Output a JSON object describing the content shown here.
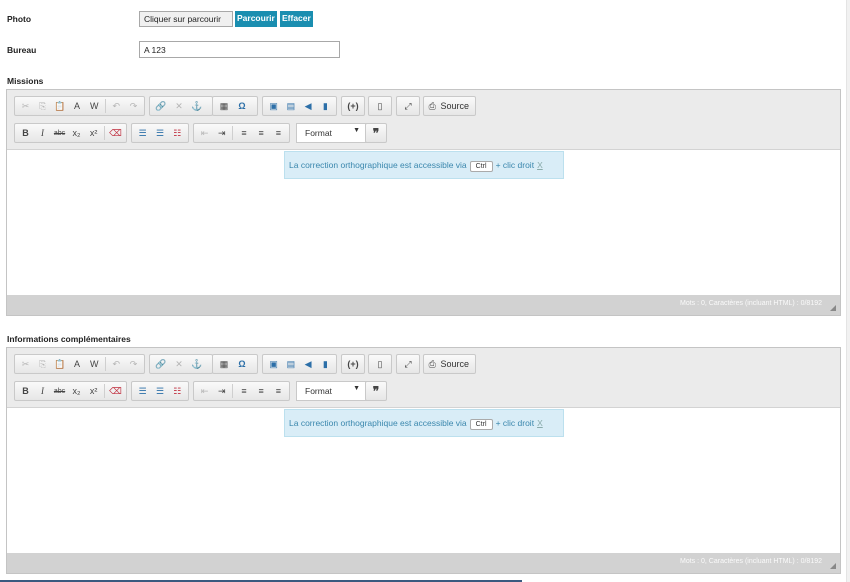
{
  "photo": {
    "label": "Photo",
    "file_button": "Cliquer sur parcourir",
    "browse": "Parcourir",
    "clear": "Effacer"
  },
  "bureau": {
    "label": "Bureau",
    "value": "A 123"
  },
  "editor_common": {
    "source": "Source",
    "format": "Format",
    "spell_pre": "La correction orthographique est accessible via",
    "spell_key": "Ctrl",
    "spell_post": "+ clic droit",
    "spell_close": "X",
    "word_count": "Mots : 0, Caractères (incluant HTML) : 0/8192"
  },
  "missions": {
    "label": "Missions"
  },
  "infos": {
    "label": "Informations complémentaires"
  },
  "colors": {
    "accent": "#1a8eb0",
    "notice_bg": "#d9edf7",
    "notice_text": "#3a87ad"
  }
}
